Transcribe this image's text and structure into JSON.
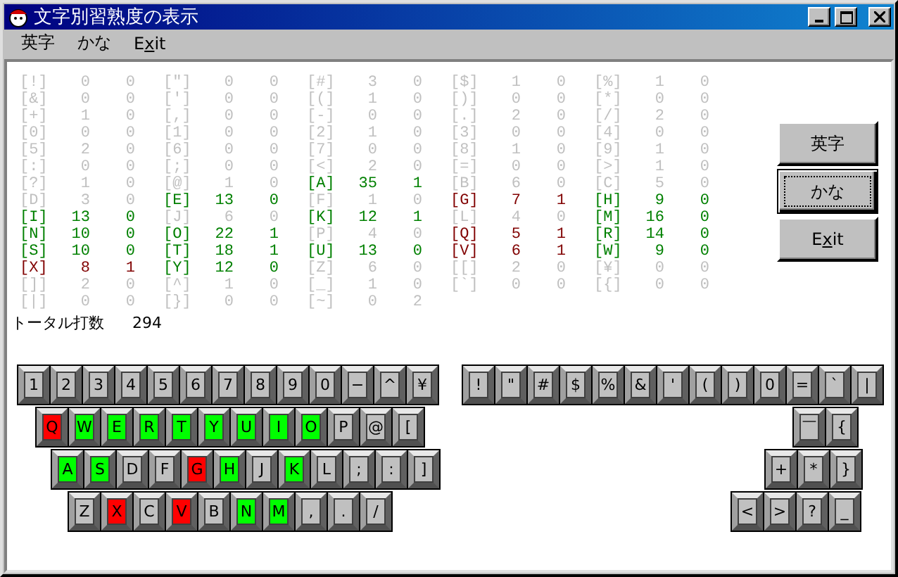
{
  "window": {
    "title": "文字別習熟度の表示"
  },
  "menu": [
    {
      "parts": [
        {
          "text": "英字"
        }
      ]
    },
    {
      "parts": [
        {
          "text": "かな"
        }
      ]
    },
    {
      "parts": [
        {
          "text": "E"
        },
        {
          "text": "x",
          "underline": true
        },
        {
          "text": "it"
        }
      ]
    }
  ],
  "stats": {
    "rows": [
      {
        "cells": [
          {
            "key": "[!]",
            "count": "0",
            "errors": "0",
            "color": "#c0c0c0"
          },
          {
            "key": "[\"]",
            "count": "0",
            "errors": "0",
            "color": "#c0c0c0"
          },
          {
            "key": "[#]",
            "count": "3",
            "errors": "0",
            "color": "#c0c0c0"
          },
          {
            "key": "[$]",
            "count": "1",
            "errors": "0",
            "color": "#c0c0c0"
          },
          {
            "key": "[%]",
            "count": "1",
            "errors": "0",
            "color": "#c0c0c0"
          }
        ]
      },
      {
        "cells": [
          {
            "key": "[&]",
            "count": "0",
            "errors": "0",
            "color": "#c0c0c0"
          },
          {
            "key": "[']",
            "count": "0",
            "errors": "0",
            "color": "#c0c0c0"
          },
          {
            "key": "[(]",
            "count": "1",
            "errors": "0",
            "color": "#c0c0c0"
          },
          {
            "key": "[)]",
            "count": "0",
            "errors": "0",
            "color": "#c0c0c0"
          },
          {
            "key": "[*]",
            "count": "0",
            "errors": "0",
            "color": "#c0c0c0"
          }
        ]
      },
      {
        "cells": [
          {
            "key": "[+]",
            "count": "1",
            "errors": "0",
            "color": "#c0c0c0"
          },
          {
            "key": "[,]",
            "count": "0",
            "errors": "0",
            "color": "#c0c0c0"
          },
          {
            "key": "[-]",
            "count": "0",
            "errors": "0",
            "color": "#c0c0c0"
          },
          {
            "key": "[.]",
            "count": "2",
            "errors": "0",
            "color": "#c0c0c0"
          },
          {
            "key": "[/]",
            "count": "2",
            "errors": "0",
            "color": "#c0c0c0"
          }
        ]
      },
      {
        "cells": [
          {
            "key": "[0]",
            "count": "0",
            "errors": "0",
            "color": "#c0c0c0"
          },
          {
            "key": "[1]",
            "count": "0",
            "errors": "0",
            "color": "#c0c0c0"
          },
          {
            "key": "[2]",
            "count": "1",
            "errors": "0",
            "color": "#c0c0c0"
          },
          {
            "key": "[3]",
            "count": "0",
            "errors": "0",
            "color": "#c0c0c0"
          },
          {
            "key": "[4]",
            "count": "0",
            "errors": "0",
            "color": "#c0c0c0"
          }
        ]
      },
      {
        "cells": [
          {
            "key": "[5]",
            "count": "2",
            "errors": "0",
            "color": "#c0c0c0"
          },
          {
            "key": "[6]",
            "count": "0",
            "errors": "0",
            "color": "#c0c0c0"
          },
          {
            "key": "[7]",
            "count": "0",
            "errors": "0",
            "color": "#c0c0c0"
          },
          {
            "key": "[8]",
            "count": "1",
            "errors": "0",
            "color": "#c0c0c0"
          },
          {
            "key": "[9]",
            "count": "1",
            "errors": "0",
            "color": "#c0c0c0"
          }
        ]
      },
      {
        "cells": [
          {
            "key": "[:]",
            "count": "0",
            "errors": "0",
            "color": "#c0c0c0"
          },
          {
            "key": "[;]",
            "count": "0",
            "errors": "0",
            "color": "#c0c0c0"
          },
          {
            "key": "[<]",
            "count": "2",
            "errors": "0",
            "color": "#c0c0c0"
          },
          {
            "key": "[=]",
            "count": "0",
            "errors": "0",
            "color": "#c0c0c0"
          },
          {
            "key": "[>]",
            "count": "1",
            "errors": "0",
            "color": "#c0c0c0"
          }
        ]
      },
      {
        "cells": [
          {
            "key": "[?]",
            "count": "1",
            "errors": "0",
            "color": "#c0c0c0"
          },
          {
            "key": "[@]",
            "count": "1",
            "errors": "0",
            "color": "#c0c0c0"
          },
          {
            "key": "[A]",
            "count": "35",
            "errors": "1",
            "color": "#008000"
          },
          {
            "key": "[B]",
            "count": "6",
            "errors": "0",
            "color": "#c0c0c0"
          },
          {
            "key": "[C]",
            "count": "5",
            "errors": "0",
            "color": "#c0c0c0"
          }
        ]
      },
      {
        "cells": [
          {
            "key": "[D]",
            "count": "3",
            "errors": "0",
            "color": "#c0c0c0"
          },
          {
            "key": "[E]",
            "count": "13",
            "errors": "0",
            "color": "#008000"
          },
          {
            "key": "[F]",
            "count": "1",
            "errors": "0",
            "color": "#c0c0c0"
          },
          {
            "key": "[G]",
            "count": "7",
            "errors": "1",
            "color": "#800000"
          },
          {
            "key": "[H]",
            "count": "9",
            "errors": "0",
            "color": "#008000"
          }
        ]
      },
      {
        "cells": [
          {
            "key": "[I]",
            "count": "13",
            "errors": "0",
            "color": "#008000"
          },
          {
            "key": "[J]",
            "count": "6",
            "errors": "0",
            "color": "#c0c0c0"
          },
          {
            "key": "[K]",
            "count": "12",
            "errors": "1",
            "color": "#008000"
          },
          {
            "key": "[L]",
            "count": "4",
            "errors": "0",
            "color": "#c0c0c0"
          },
          {
            "key": "[M]",
            "count": "16",
            "errors": "0",
            "color": "#008000"
          }
        ]
      },
      {
        "cells": [
          {
            "key": "[N]",
            "count": "10",
            "errors": "0",
            "color": "#008000"
          },
          {
            "key": "[O]",
            "count": "22",
            "errors": "1",
            "color": "#008000"
          },
          {
            "key": "[P]",
            "count": "4",
            "errors": "0",
            "color": "#c0c0c0"
          },
          {
            "key": "[Q]",
            "count": "5",
            "errors": "1",
            "color": "#800000"
          },
          {
            "key": "[R]",
            "count": "14",
            "errors": "0",
            "color": "#008000"
          }
        ]
      },
      {
        "cells": [
          {
            "key": "[S]",
            "count": "10",
            "errors": "0",
            "color": "#008000"
          },
          {
            "key": "[T]",
            "count": "18",
            "errors": "1",
            "color": "#008000"
          },
          {
            "key": "[U]",
            "count": "13",
            "errors": "0",
            "color": "#008000"
          },
          {
            "key": "[V]",
            "count": "6",
            "errors": "1",
            "color": "#800000"
          },
          {
            "key": "[W]",
            "count": "9",
            "errors": "0",
            "color": "#008000"
          }
        ]
      },
      {
        "cells": [
          {
            "key": "[X]",
            "count": "8",
            "errors": "1",
            "color": "#800000"
          },
          {
            "key": "[Y]",
            "count": "12",
            "errors": "0",
            "color": "#008000"
          },
          {
            "key": "[Z]",
            "count": "6",
            "errors": "0",
            "color": "#c0c0c0"
          },
          {
            "key": "[[]",
            "count": "2",
            "errors": "0",
            "color": "#c0c0c0"
          },
          {
            "key": "[¥]",
            "count": "0",
            "errors": "0",
            "color": "#c0c0c0"
          }
        ]
      },
      {
        "cells": [
          {
            "key": "[]]",
            "count": "2",
            "errors": "0",
            "color": "#c0c0c0"
          },
          {
            "key": "[^]",
            "count": "1",
            "errors": "0",
            "color": "#c0c0c0"
          },
          {
            "key": "[_]",
            "count": "1",
            "errors": "0",
            "color": "#c0c0c0"
          },
          {
            "key": "[`]",
            "count": "0",
            "errors": "0",
            "color": "#c0c0c0"
          },
          {
            "key": "[{]",
            "count": "0",
            "errors": "0",
            "color": "#c0c0c0"
          }
        ]
      },
      {
        "cells": [
          {
            "key": "[|]",
            "count": "0",
            "errors": "0",
            "color": "#c0c0c0"
          },
          {
            "key": "[}]",
            "count": "0",
            "errors": "0",
            "color": "#c0c0c0"
          },
          {
            "key": "[~]",
            "count": "0",
            "errors": "2",
            "color": "#c0c0c0"
          }
        ]
      }
    ],
    "total_label": "トータル打数",
    "total_value": "294"
  },
  "buttons": [
    {
      "parts": [
        {
          "text": "英字"
        }
      ],
      "focused": false
    },
    {
      "parts": [
        {
          "text": "かな"
        }
      ],
      "focused": true
    },
    {
      "parts": [
        {
          "text": "E"
        },
        {
          "text": "x",
          "underline": true
        },
        {
          "text": "it"
        }
      ],
      "focused": false
    }
  ],
  "keyboard_left": [
    {
      "keys": [
        {
          "label": "1"
        },
        {
          "label": "2"
        },
        {
          "label": "3"
        },
        {
          "label": "4"
        },
        {
          "label": "5"
        },
        {
          "label": "6"
        },
        {
          "label": "7"
        },
        {
          "label": "8"
        },
        {
          "label": "9"
        },
        {
          "label": "0"
        },
        {
          "label": "−"
        },
        {
          "label": "^"
        },
        {
          "label": "¥"
        }
      ]
    },
    {
      "keys": [
        {
          "label": "Q",
          "color": "#ff0000"
        },
        {
          "label": "W",
          "color": "#00ff00"
        },
        {
          "label": "E",
          "color": "#00ff00"
        },
        {
          "label": "R",
          "color": "#00ff00"
        },
        {
          "label": "T",
          "color": "#00ff00"
        },
        {
          "label": "Y",
          "color": "#00ff00"
        },
        {
          "label": "U",
          "color": "#00ff00"
        },
        {
          "label": "I",
          "color": "#00ff00"
        },
        {
          "label": "O",
          "color": "#00ff00"
        },
        {
          "label": "P"
        },
        {
          "label": "@"
        },
        {
          "label": "["
        }
      ]
    },
    {
      "keys": [
        {
          "label": "A",
          "color": "#00ff00"
        },
        {
          "label": "S",
          "color": "#00ff00"
        },
        {
          "label": "D"
        },
        {
          "label": "F"
        },
        {
          "label": "G",
          "color": "#ff0000"
        },
        {
          "label": "H",
          "color": "#00ff00"
        },
        {
          "label": "J"
        },
        {
          "label": "K",
          "color": "#00ff00"
        },
        {
          "label": "L"
        },
        {
          "label": ";"
        },
        {
          "label": ":"
        },
        {
          "label": "]"
        }
      ]
    },
    {
      "keys": [
        {
          "label": "Z"
        },
        {
          "label": "X",
          "color": "#ff0000"
        },
        {
          "label": "C"
        },
        {
          "label": "V",
          "color": "#ff0000"
        },
        {
          "label": "B"
        },
        {
          "label": "N",
          "color": "#00ff00"
        },
        {
          "label": "M",
          "color": "#00ff00"
        },
        {
          "label": ","
        },
        {
          "label": "."
        },
        {
          "label": "/"
        }
      ]
    }
  ],
  "keyboard_right": [
    {
      "keys": [
        {
          "label": "!"
        },
        {
          "label": "\""
        },
        {
          "label": "#"
        },
        {
          "label": "$"
        },
        {
          "label": "%"
        },
        {
          "label": "&"
        },
        {
          "label": "'"
        },
        {
          "label": "("
        },
        {
          "label": ")"
        },
        {
          "label": "0"
        },
        {
          "label": "="
        },
        {
          "label": "`"
        },
        {
          "label": "|"
        }
      ]
    },
    {
      "keys": [
        {
          "label": "￣"
        },
        {
          "label": "{"
        }
      ]
    },
    {
      "keys": [
        {
          "label": "+"
        },
        {
          "label": "*"
        },
        {
          "label": "}"
        }
      ]
    },
    {
      "keys": [
        {
          "label": "<"
        },
        {
          "label": ">"
        },
        {
          "label": "?"
        },
        {
          "label": "_"
        }
      ]
    }
  ]
}
